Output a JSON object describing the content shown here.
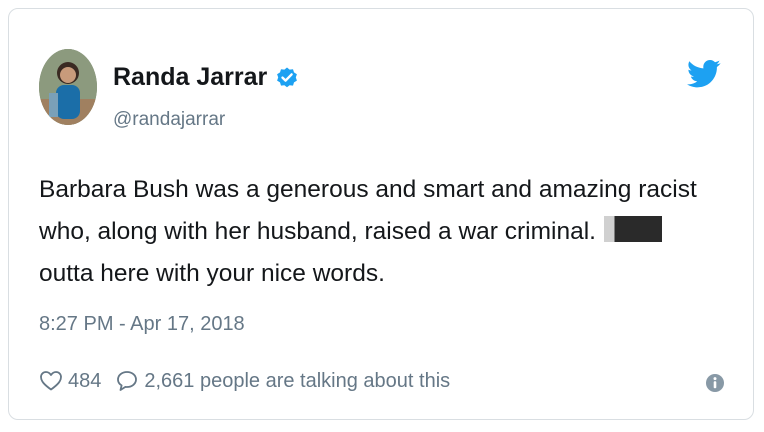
{
  "user": {
    "display_name": "Randa Jarrar",
    "handle": "@randajarrar",
    "avatar_icon": "profile-photo",
    "verified_icon": "verified-badge-icon"
  },
  "tweet": {
    "line1": "Barbara Bush was a generous and smart and amazing racist",
    "line2": "who, along with her husband, raised a war criminal.",
    "line3": "outta here with your nice words.",
    "timestamp": "8:27 PM - Apr 17, 2018"
  },
  "stats": {
    "likes": "484",
    "talking": "2,661 people are talking about this"
  },
  "icons": {
    "brand": "twitter-bird-icon",
    "like": "heart-icon",
    "reply": "speech-bubble-icon",
    "info": "info-icon"
  },
  "colors": {
    "accent": "#1da1f2",
    "secondary_text": "#657786"
  }
}
